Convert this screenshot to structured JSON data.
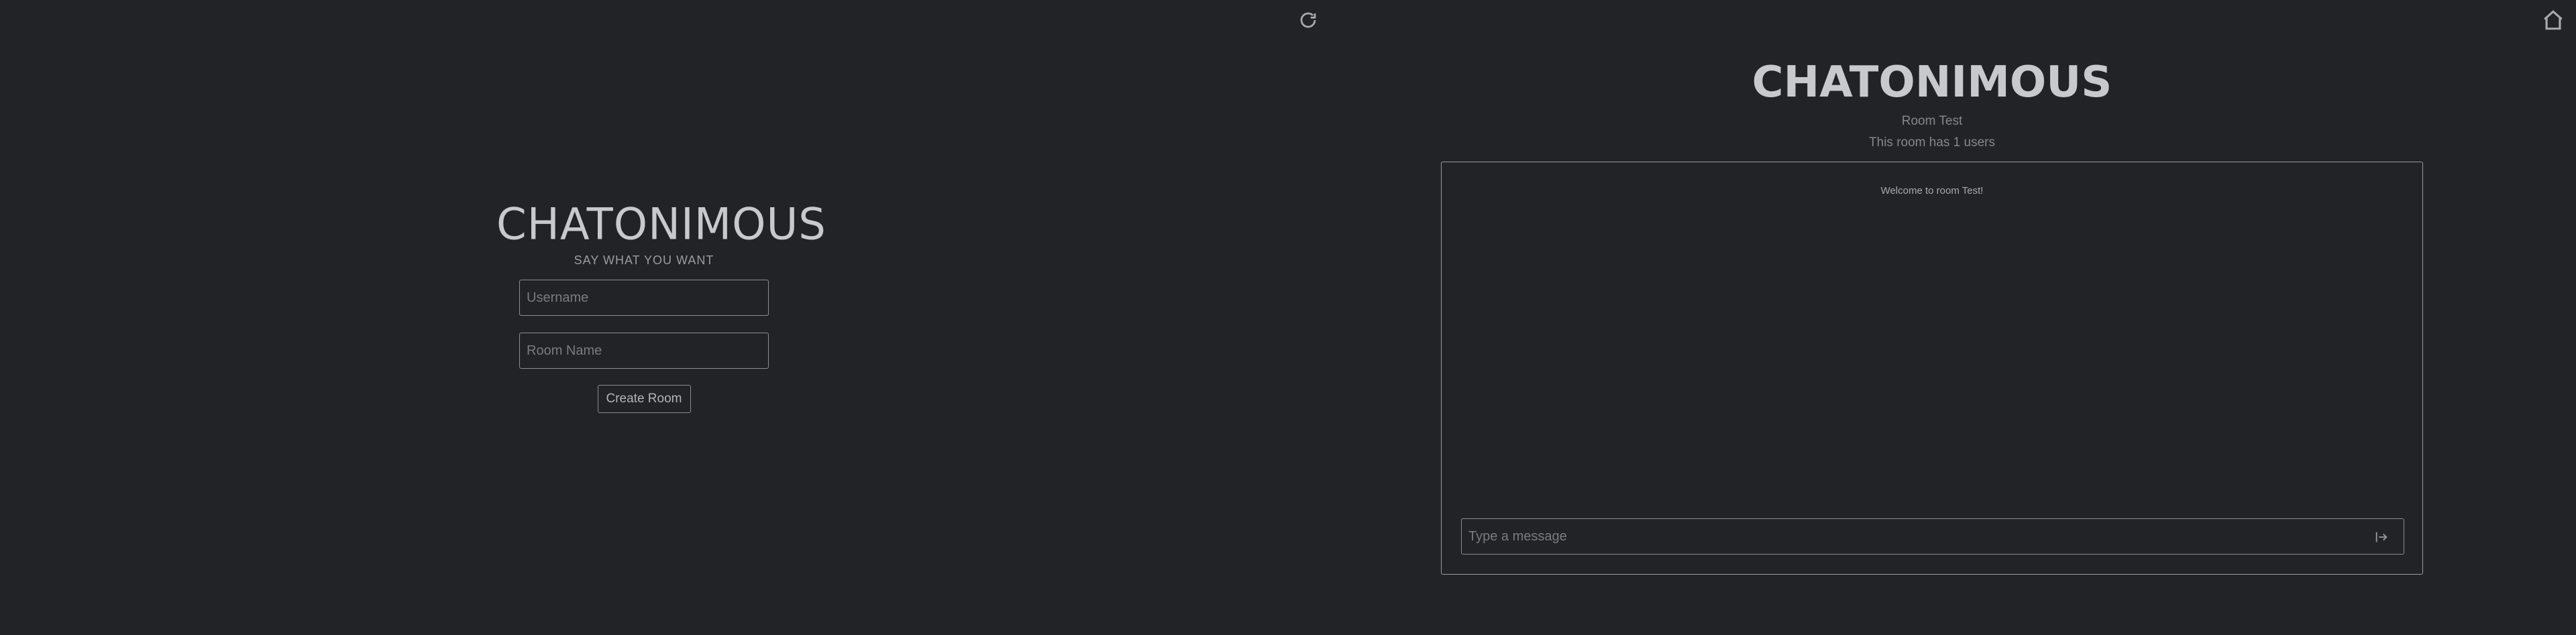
{
  "toolbar": {
    "refresh_icon": "refresh-icon",
    "home_icon": "home-icon"
  },
  "create_panel": {
    "title": "CHATONIMOUS",
    "subtitle": "SAY WHAT YOU WANT",
    "username_placeholder": "Username",
    "username_value": "",
    "room_placeholder": "Room Name",
    "room_value": "",
    "create_label": "Create Room"
  },
  "chat_panel": {
    "title": "CHATONIMOUS",
    "room_name": "Room Test",
    "users_text": "This room has 1 users",
    "messages": [
      {
        "text": "Welcome to room Test!"
      }
    ],
    "message_placeholder": "Type a message",
    "message_value": "",
    "send_icon": "send-icon"
  },
  "colors": {
    "background": "#222327",
    "border": "#9a9ba0",
    "text": "#c8c9cc"
  }
}
